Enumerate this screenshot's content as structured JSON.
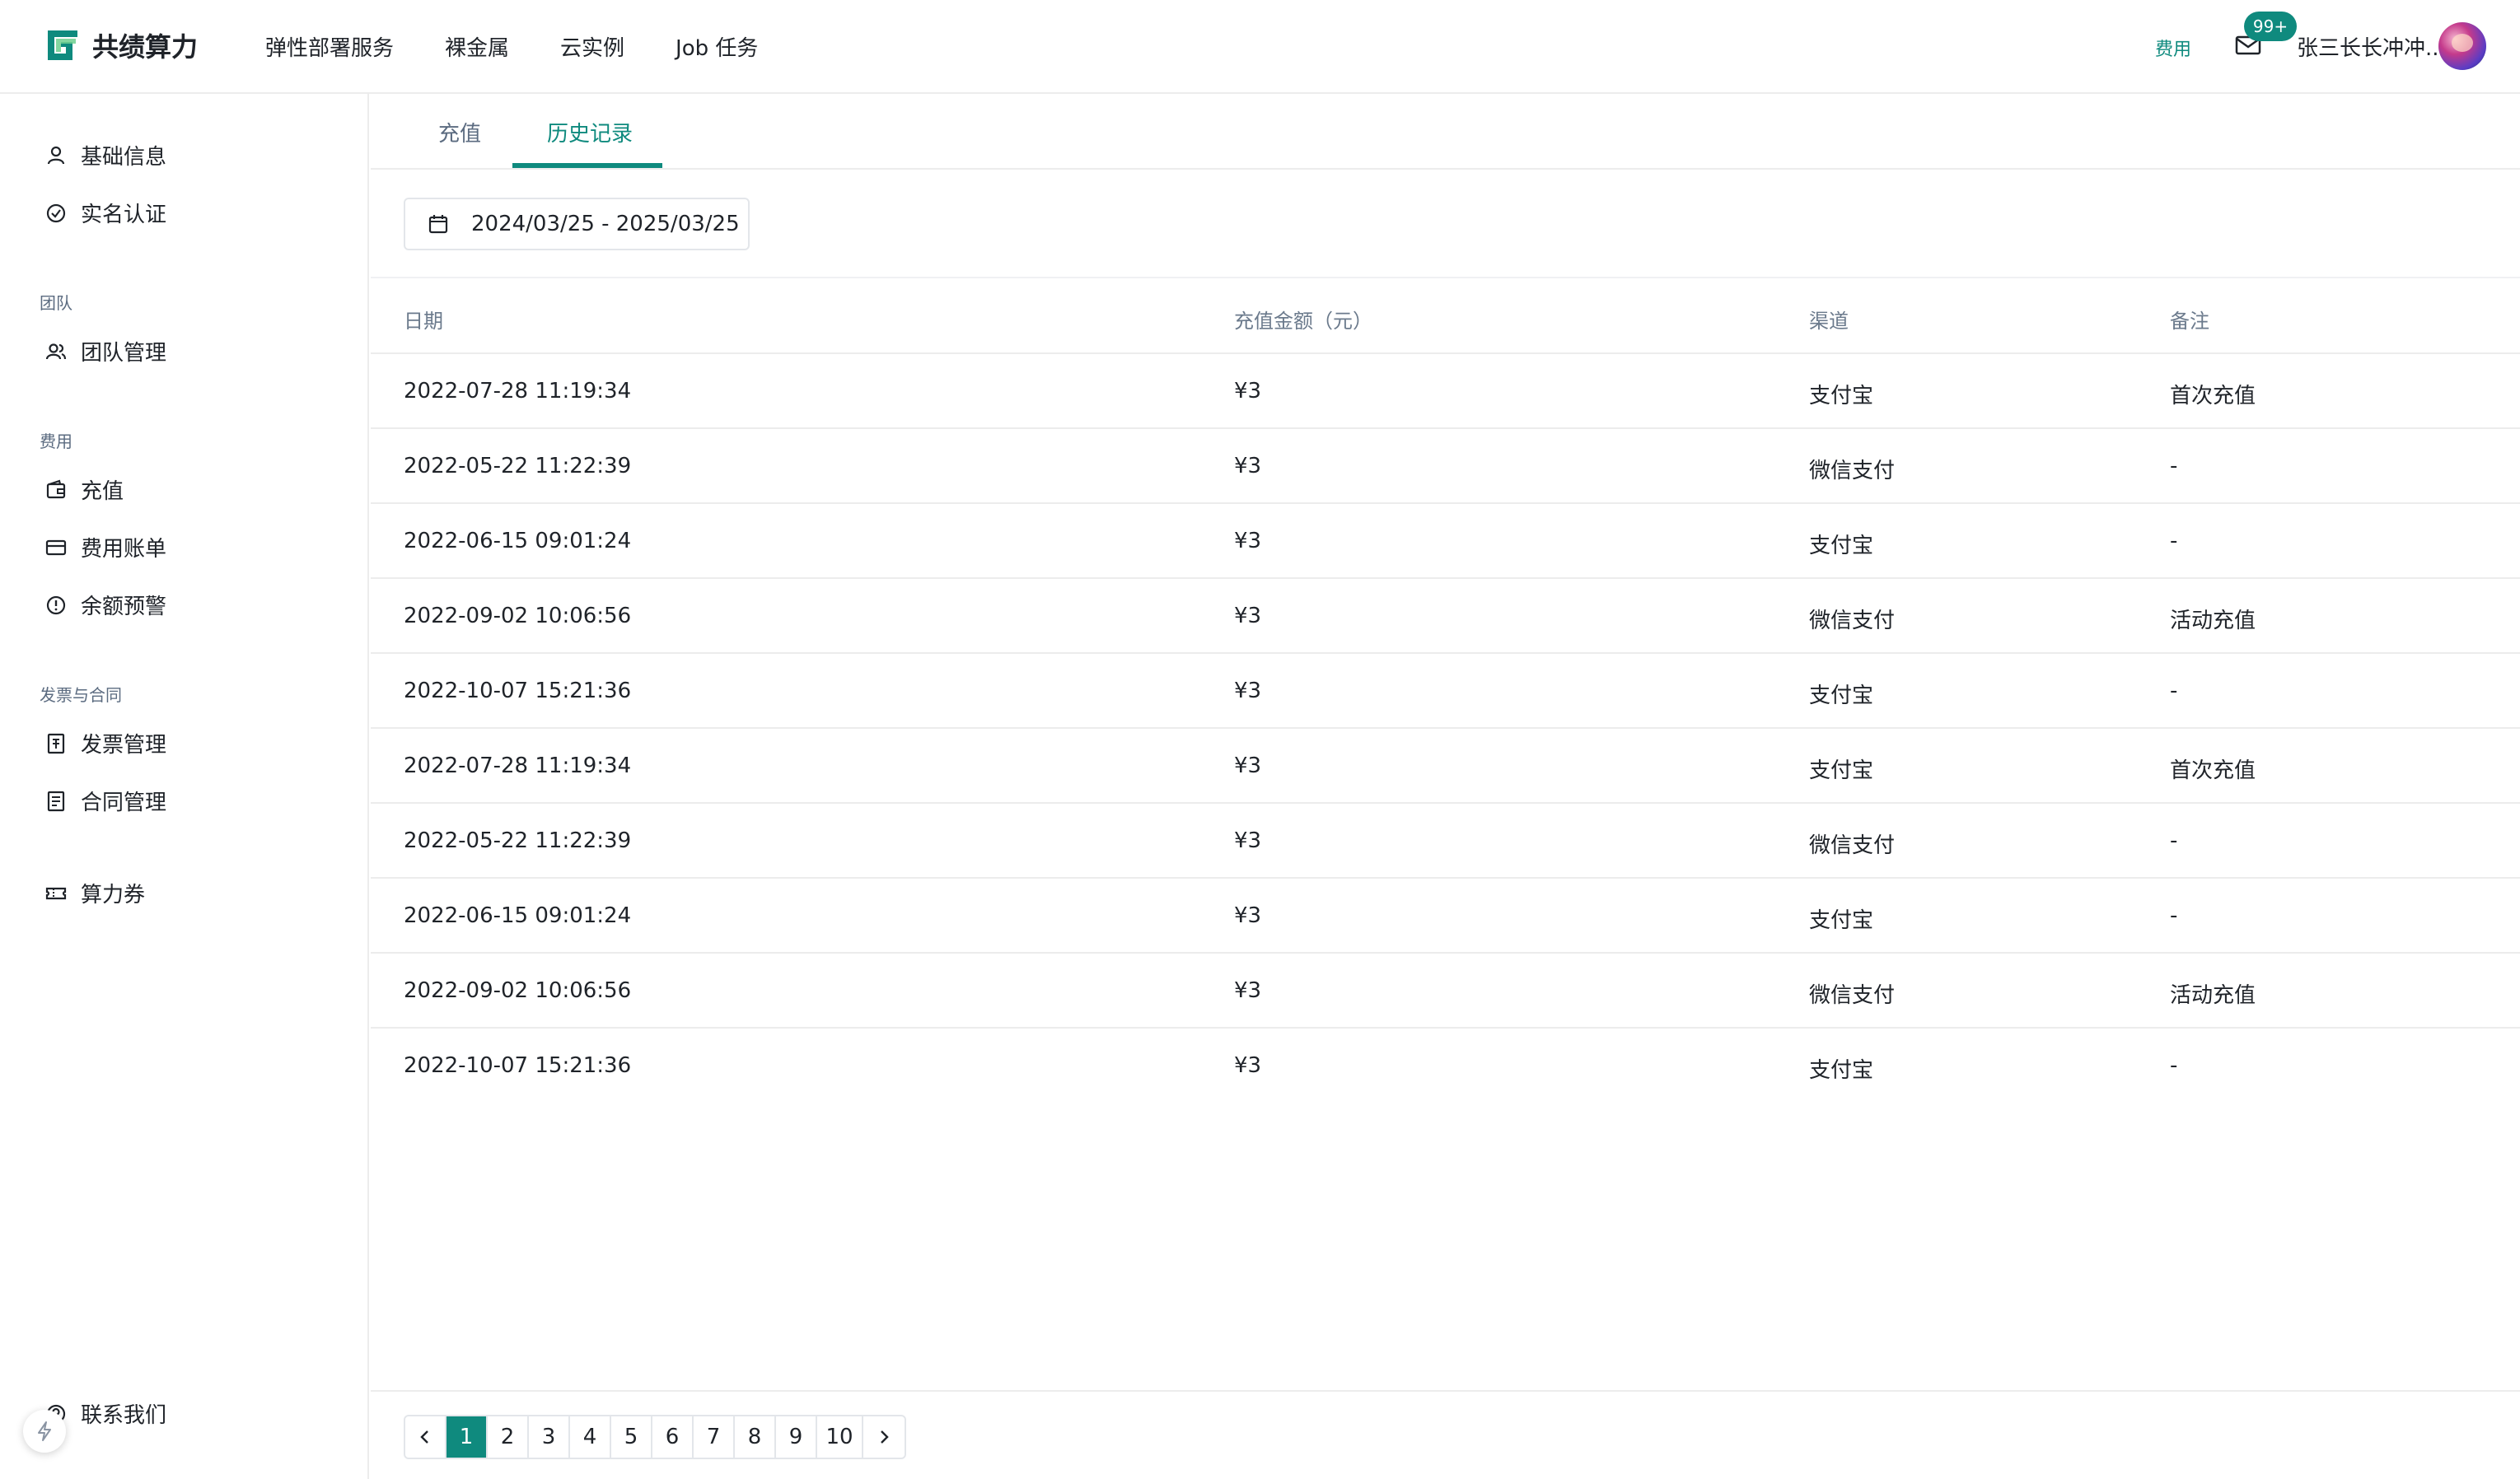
{
  "header": {
    "logo_text": "共绩算力",
    "nav": [
      "弹性部署服务",
      "裸金属",
      "云实例",
      "Job 任务"
    ],
    "fee_link": "费用",
    "mail_badge": "99+",
    "username": "张三长长冲冲.."
  },
  "sidebar": {
    "basic_info": "基础信息",
    "verify": "实名认证",
    "group_team": "团队",
    "team_manage": "团队管理",
    "group_fee": "费用",
    "recharge": "充值",
    "bill": "费用账单",
    "balance_alert": "余额预警",
    "group_invoice": "发票与合同",
    "invoice_manage": "发票管理",
    "contract_manage": "合同管理",
    "coupon": "算力券",
    "contact": "联系我们"
  },
  "tabs": {
    "recharge": "充值",
    "history": "历史记录"
  },
  "filter": {
    "date_range": "2024/03/25 - 2025/03/25"
  },
  "table": {
    "columns": [
      "日期",
      "充值金额（元）",
      "渠道",
      "备注"
    ],
    "rows": [
      [
        "2022-07-28 11:19:34",
        "¥3",
        "支付宝",
        "首次充值"
      ],
      [
        "2022-05-22 11:22:39",
        "¥3",
        "微信支付",
        "-"
      ],
      [
        "2022-06-15 09:01:24",
        "¥3",
        "支付宝",
        "-"
      ],
      [
        "2022-09-02 10:06:56",
        "¥3",
        "微信支付",
        "活动充值"
      ],
      [
        "2022-10-07 15:21:36",
        "¥3",
        "支付宝",
        "-"
      ],
      [
        "2022-07-28 11:19:34",
        "¥3",
        "支付宝",
        "首次充值"
      ],
      [
        "2022-05-22 11:22:39",
        "¥3",
        "微信支付",
        "-"
      ],
      [
        "2022-06-15 09:01:24",
        "¥3",
        "支付宝",
        "-"
      ],
      [
        "2022-09-02 10:06:56",
        "¥3",
        "微信支付",
        "活动充值"
      ],
      [
        "2022-10-07 15:21:36",
        "¥3",
        "支付宝",
        "-"
      ]
    ]
  },
  "pagination": {
    "pages": [
      "1",
      "2",
      "3",
      "4",
      "5",
      "6",
      "7",
      "8",
      "9",
      "10"
    ],
    "current": "1"
  },
  "colors": {
    "accent": "#0f8a7e",
    "text": "#1f2329",
    "muted": "#5b6b80",
    "border": "#ececec"
  },
  "icons": {
    "logo": "logo-icon",
    "mail": "mail-icon",
    "user": "user-icon",
    "verify": "check-circle-icon",
    "team": "team-icon",
    "wallet": "wallet-icon",
    "card": "card-icon",
    "alert": "alert-circle-icon",
    "invoice": "invoice-icon",
    "contract": "contract-icon",
    "coupon": "ticket-icon",
    "help": "help-icon",
    "calendar": "calendar-icon",
    "prev": "chevron-left-icon",
    "next": "chevron-right-icon",
    "bolt": "lightning-icon"
  }
}
